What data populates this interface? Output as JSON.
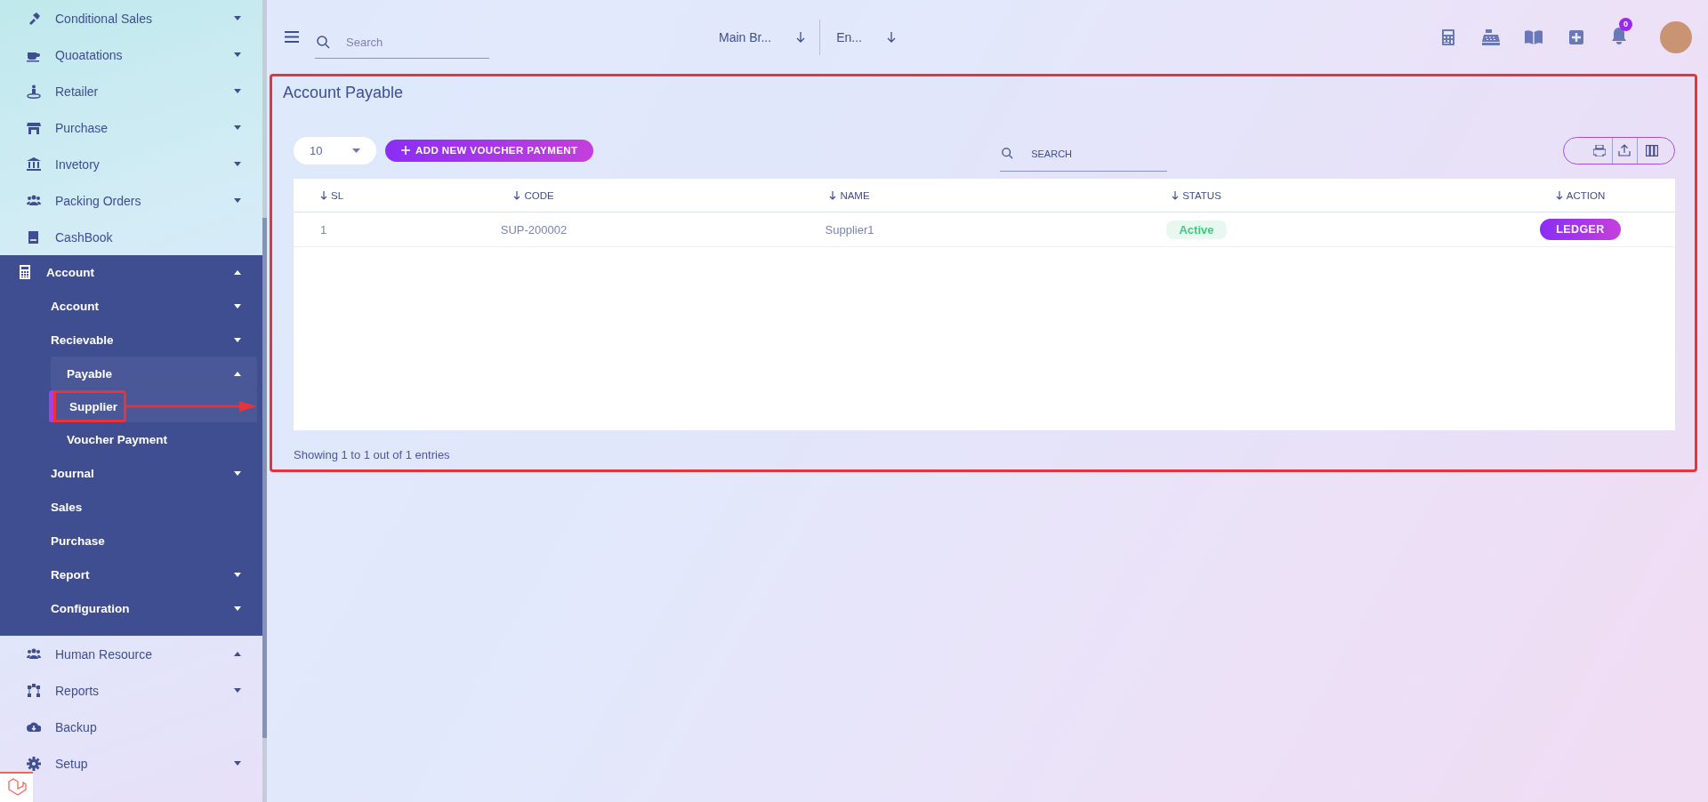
{
  "sidebar": {
    "items": [
      {
        "label": "Conditional Sales",
        "expanded": false,
        "selected": false
      },
      {
        "label": "Quoatations",
        "expanded": false,
        "selected": false
      },
      {
        "label": "Retailer",
        "expanded": false,
        "selected": false
      },
      {
        "label": "Purchase",
        "expanded": false,
        "selected": false
      },
      {
        "label": "Invetory",
        "expanded": false,
        "selected": false
      },
      {
        "label": "Packing Orders",
        "expanded": false,
        "selected": false
      },
      {
        "label": "CashBook",
        "selected": false
      },
      {
        "label": "Account",
        "expanded": true,
        "selected": false,
        "children": [
          {
            "label": "Account",
            "expanded": false,
            "selected": false
          },
          {
            "label": "Recievable",
            "expanded": false,
            "selected": false
          },
          {
            "label": "Payable",
            "expanded": true,
            "selected": false,
            "children": [
              {
                "label": "Supplier",
                "selected": true
              },
              {
                "label": "Voucher Payment",
                "selected": false
              }
            ]
          },
          {
            "label": "Journal",
            "expanded": false,
            "selected": false
          },
          {
            "label": "Sales",
            "selected": false
          },
          {
            "label": "Purchase",
            "selected": false
          },
          {
            "label": "Report",
            "expanded": false,
            "selected": false
          },
          {
            "label": "Configuration",
            "expanded": false,
            "selected": false
          }
        ]
      },
      {
        "label": "Human Resource",
        "expanded": true,
        "selected": false
      },
      {
        "label": "Reports",
        "expanded": false,
        "selected": false
      },
      {
        "label": "Backup",
        "selected": false
      },
      {
        "label": "Setup",
        "expanded": false,
        "selected": false
      }
    ]
  },
  "topbar": {
    "search": {
      "placeholder": "Search"
    },
    "branch": "Main Br...",
    "language": "En...",
    "notification_count": "0"
  },
  "page": {
    "title": "Account Payable",
    "page_size": "10",
    "add_button": "ADD NEW VOUCHER PAYMENT",
    "search": {
      "placeholder": "SEARCH"
    },
    "table": {
      "columns": [
        "SL",
        "CODE",
        "NAME",
        "STATUS",
        "ACTION"
      ],
      "rows": [
        {
          "sl": "1",
          "code": "SUP-200002",
          "name": "Supplier1",
          "status": "Active",
          "action": "LEDGER"
        }
      ]
    },
    "footer": "Showing 1 to 1 out of 1 entries"
  }
}
